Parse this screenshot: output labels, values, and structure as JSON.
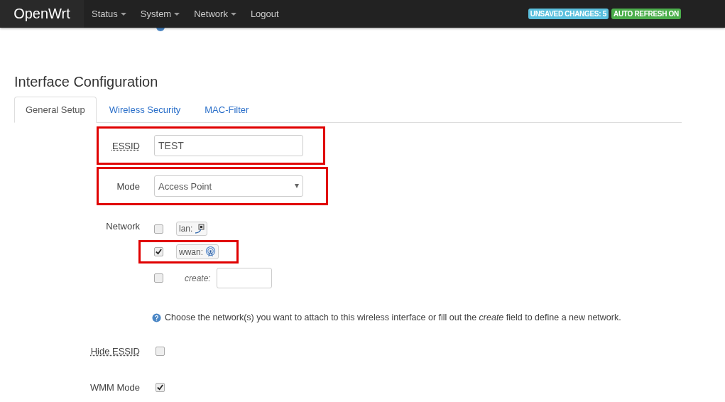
{
  "navbar": {
    "brand": "OpenWrt",
    "menu": [
      {
        "label": "Status",
        "dropdown": true
      },
      {
        "label": "System",
        "dropdown": true
      },
      {
        "label": "Network",
        "dropdown": true
      },
      {
        "label": "Logout",
        "dropdown": false
      }
    ],
    "badges": [
      {
        "label": "UNSAVED CHANGES: 5",
        "color": "#5bc0de"
      },
      {
        "label": "AUTO REFRESH ON",
        "color": "#4cae4c"
      }
    ]
  },
  "section_title": "Interface Configuration",
  "tabs": [
    {
      "label": "General Setup",
      "selected": true
    },
    {
      "label": "Wireless Security",
      "selected": false
    },
    {
      "label": "MAC-Filter",
      "selected": false
    }
  ],
  "fields": [
    {
      "kind": "text",
      "label": "ESSID",
      "label_tooltip": true,
      "value": "TEST",
      "highlighted": true
    },
    {
      "kind": "select",
      "label": "Mode",
      "label_tooltip": false,
      "value": "Access Point",
      "highlighted": true
    },
    {
      "kind": "networks",
      "label": "Network",
      "label_tooltip": false,
      "highlighted": false,
      "options": [
        {
          "kind": "wired",
          "label": "lan:",
          "checked": false,
          "highlighted": false
        },
        {
          "kind": "wireless",
          "label": "wwan:",
          "checked": true,
          "highlighted": true
        },
        {
          "kind": "create",
          "label": "create:",
          "checked": false,
          "highlighted": false
        }
      ],
      "help": "Choose the network(s) you want to attach to this wireless interface or fill out the *create* field to define a new network."
    },
    {
      "kind": "checkbox",
      "label": "Hide ESSID",
      "label_tooltip": true,
      "checked": false,
      "highlighted": false
    },
    {
      "kind": "checkbox",
      "label": "WMM Mode",
      "label_tooltip": false,
      "checked": true,
      "highlighted": false
    }
  ]
}
